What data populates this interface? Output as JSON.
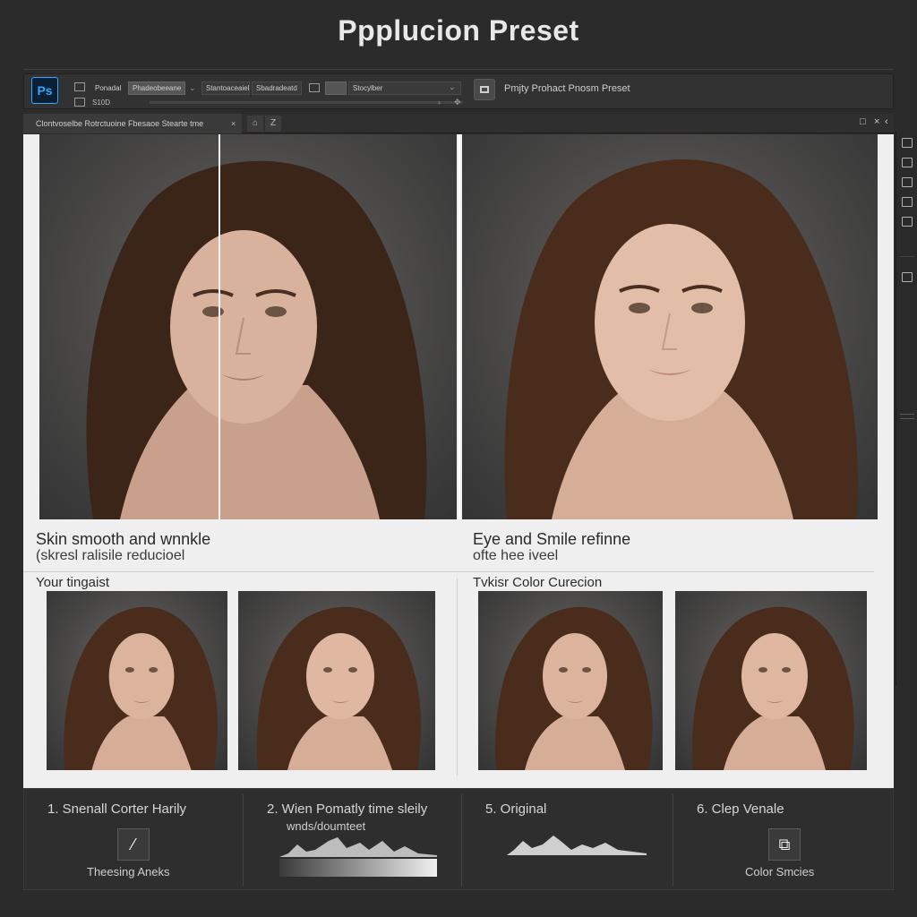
{
  "page_title": "Ppplucion Preset",
  "options_bar": {
    "app_logo": "Ps",
    "field_1": "Ponadal",
    "field_2": "Phadeobeeane",
    "field_3": "Stantoaceaiel",
    "field_4": "Sbadradeatd",
    "field_5": "Stocylber",
    "small_text": "S10D",
    "preset_label": "Pmjty Prohact Pnosm Preset"
  },
  "document_tab": {
    "label": "Clontvoselbe Rotrctuoine Fbesaoe Stearte tme",
    "close": "×"
  },
  "window_buttons": {
    "restore": "□",
    "close": "×",
    "collapse": "‹"
  },
  "sections": {
    "left_title": "Skin smooth and wnnkle",
    "left_subtitle": "(skresl ralisile reducioel",
    "right_title": "Eye and Smile refinne",
    "right_subtitle": "ofte hee iveel",
    "left_group": "Your tingaist",
    "right_group": "Tvkisr Color Curecion"
  },
  "steps": [
    {
      "title": "1.  Snenall Corter Harily",
      "caption": "Theesing Aneks",
      "icon": "brush-icon",
      "glyph": "⁄"
    },
    {
      "title": "2.  Wien Pomatly time sleily",
      "subtitle": "wnds/doumteet"
    },
    {
      "title": "5.  Original"
    },
    {
      "title": "6.  Clep Venale",
      "caption": "Color Smcies",
      "icon": "color-swatch-icon",
      "glyph": "⧉"
    }
  ],
  "colors": {
    "app_bg": "#2b2b2b",
    "panel_bg": "#323232",
    "canvas_bg": "#efefef",
    "accent_blue": "#31a8ff",
    "hair": "#3b2418"
  }
}
